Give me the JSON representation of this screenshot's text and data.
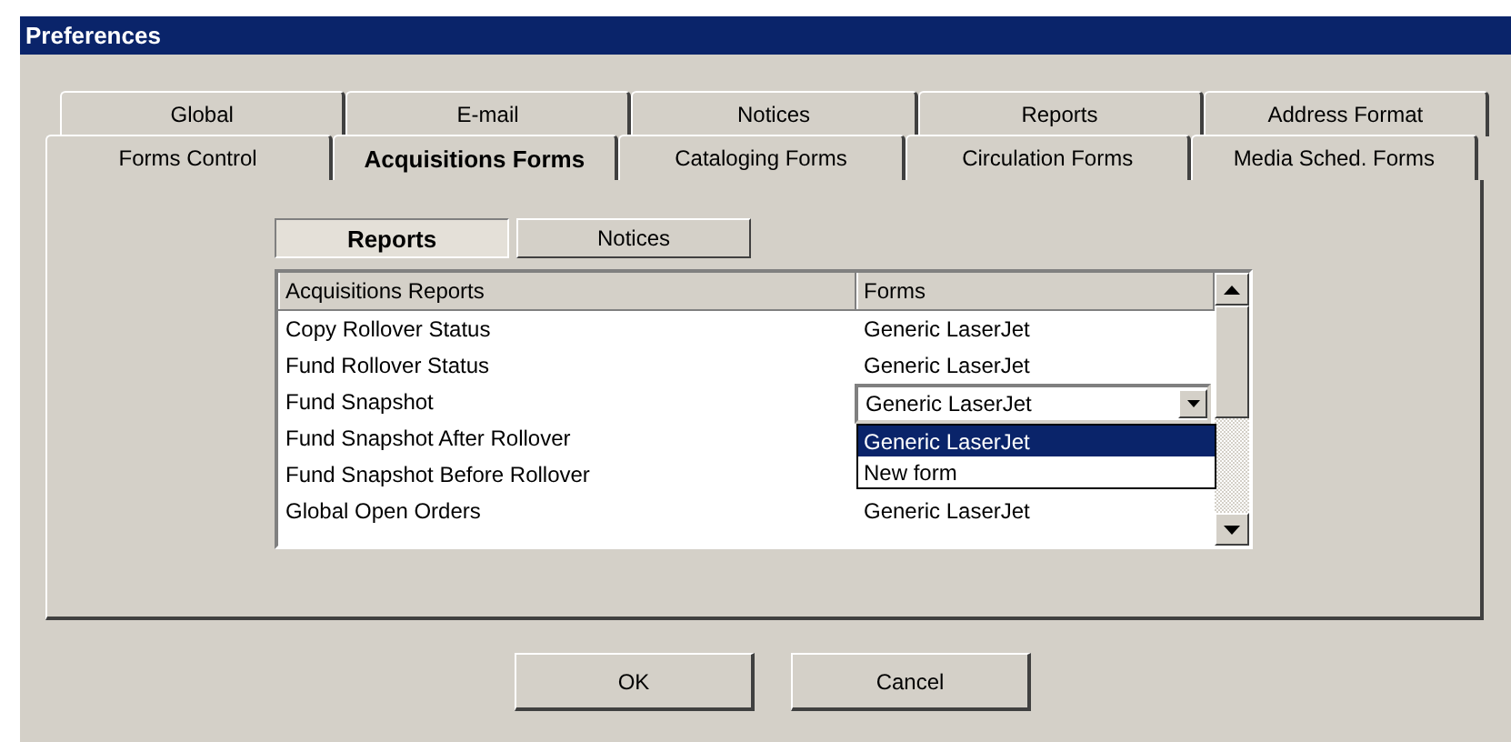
{
  "window": {
    "title": "Preferences"
  },
  "tab_rows": [
    [
      {
        "label": "Global",
        "selected": false
      },
      {
        "label": "E-mail",
        "selected": false
      },
      {
        "label": "Notices",
        "selected": false
      },
      {
        "label": "Reports",
        "selected": false
      },
      {
        "label": "Address Format",
        "selected": false
      }
    ],
    [
      {
        "label": "Forms Control",
        "selected": false
      },
      {
        "label": "Acquisitions Forms",
        "selected": true
      },
      {
        "label": "Cataloging Forms",
        "selected": false
      },
      {
        "label": "Circulation Forms",
        "selected": false
      },
      {
        "label": "Media Sched. Forms",
        "selected": false
      }
    ]
  ],
  "sub_tabs": [
    {
      "label": "Reports",
      "selected": true
    },
    {
      "label": "Notices",
      "selected": false
    }
  ],
  "table": {
    "columns": [
      "Acquisitions Reports",
      "Forms"
    ],
    "rows": [
      {
        "name": "Copy Rollover Status",
        "form": "Generic LaserJet",
        "kind": "text"
      },
      {
        "name": "Fund Rollover Status",
        "form": "Generic LaserJet",
        "kind": "text"
      },
      {
        "name": "Fund Snapshot",
        "form": "Generic LaserJet",
        "kind": "combo"
      },
      {
        "name": "Fund Snapshot After Rollover",
        "kind": "covered"
      },
      {
        "name": "Fund Snapshot Before Rollover",
        "kind": "covered"
      },
      {
        "name": "Global Open Orders",
        "form": "Generic LaserJet",
        "kind": "text"
      }
    ]
  },
  "dropdown": {
    "items": [
      {
        "label": "Generic LaserJet",
        "selected": true
      },
      {
        "label": "New form",
        "selected": false
      }
    ]
  },
  "buttons": [
    "OK",
    "Cancel"
  ]
}
